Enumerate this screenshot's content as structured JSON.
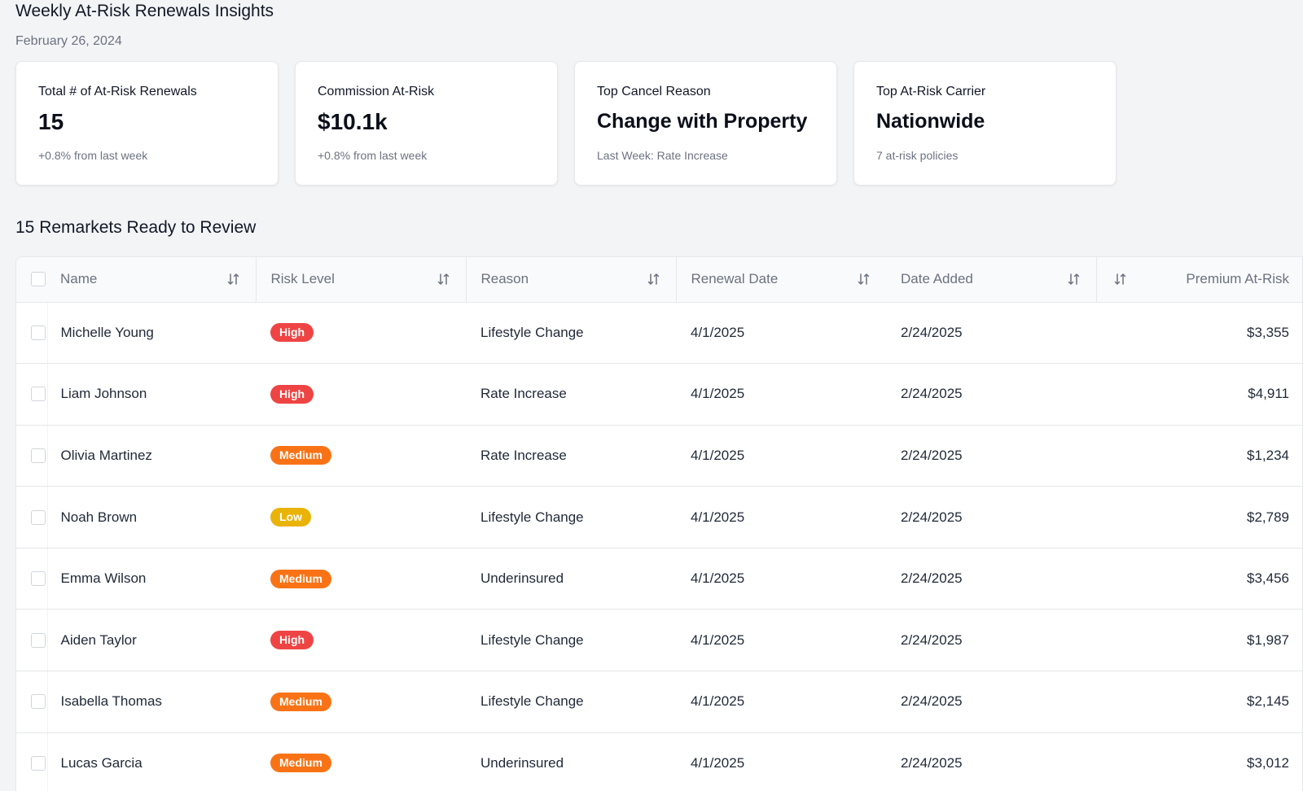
{
  "header": {
    "title": "Weekly At-Risk Renewals Insights",
    "date": "February 26, 2024"
  },
  "cards": [
    {
      "label": "Total # of At-Risk Renewals",
      "value": "15",
      "sub": "+0.8% from last week"
    },
    {
      "label": "Commission At-Risk",
      "value": "$10.1k",
      "sub": "+0.8% from last week"
    },
    {
      "label": "Top Cancel Reason",
      "value": "Change with Property",
      "sub": "Last Week: Rate Increase"
    },
    {
      "label": "Top At-Risk Carrier",
      "value": "Nationwide",
      "sub": "7 at-risk policies"
    }
  ],
  "section_title": "15 Remarkets Ready to Review",
  "table": {
    "columns": [
      "Name",
      "Risk Level",
      "Reason",
      "Renewal Date",
      "Date Added",
      "Premium At-Risk"
    ],
    "rows": [
      {
        "name": "Michelle Young",
        "risk": "High",
        "reason": "Lifestyle Change",
        "renewal": "4/1/2025",
        "added": "2/24/2025",
        "premium": "$3,355"
      },
      {
        "name": "Liam Johnson",
        "risk": "High",
        "reason": "Rate Increase",
        "renewal": "4/1/2025",
        "added": "2/24/2025",
        "premium": "$4,911"
      },
      {
        "name": "Olivia Martinez",
        "risk": "Medium",
        "reason": "Rate Increase",
        "renewal": "4/1/2025",
        "added": "2/24/2025",
        "premium": "$1,234"
      },
      {
        "name": "Noah Brown",
        "risk": "Low",
        "reason": "Lifestyle Change",
        "renewal": "4/1/2025",
        "added": "2/24/2025",
        "premium": "$2,789"
      },
      {
        "name": "Emma Wilson",
        "risk": "Medium",
        "reason": "Underinsured",
        "renewal": "4/1/2025",
        "added": "2/24/2025",
        "premium": "$3,456"
      },
      {
        "name": "Aiden Taylor",
        "risk": "High",
        "reason": "Lifestyle Change",
        "renewal": "4/1/2025",
        "added": "2/24/2025",
        "premium": "$1,987"
      },
      {
        "name": "Isabella Thomas",
        "risk": "Medium",
        "reason": "Lifestyle Change",
        "renewal": "4/1/2025",
        "added": "2/24/2025",
        "premium": "$2,145"
      },
      {
        "name": "Lucas Garcia",
        "risk": "Medium",
        "reason": "Underinsured",
        "renewal": "4/1/2025",
        "added": "2/24/2025",
        "premium": "$3,012"
      }
    ]
  },
  "colors": {
    "high": "#ef4444",
    "medium": "#f97316",
    "low": "#eab308"
  },
  "icons": {
    "sort": "sort-arrows-icon"
  }
}
